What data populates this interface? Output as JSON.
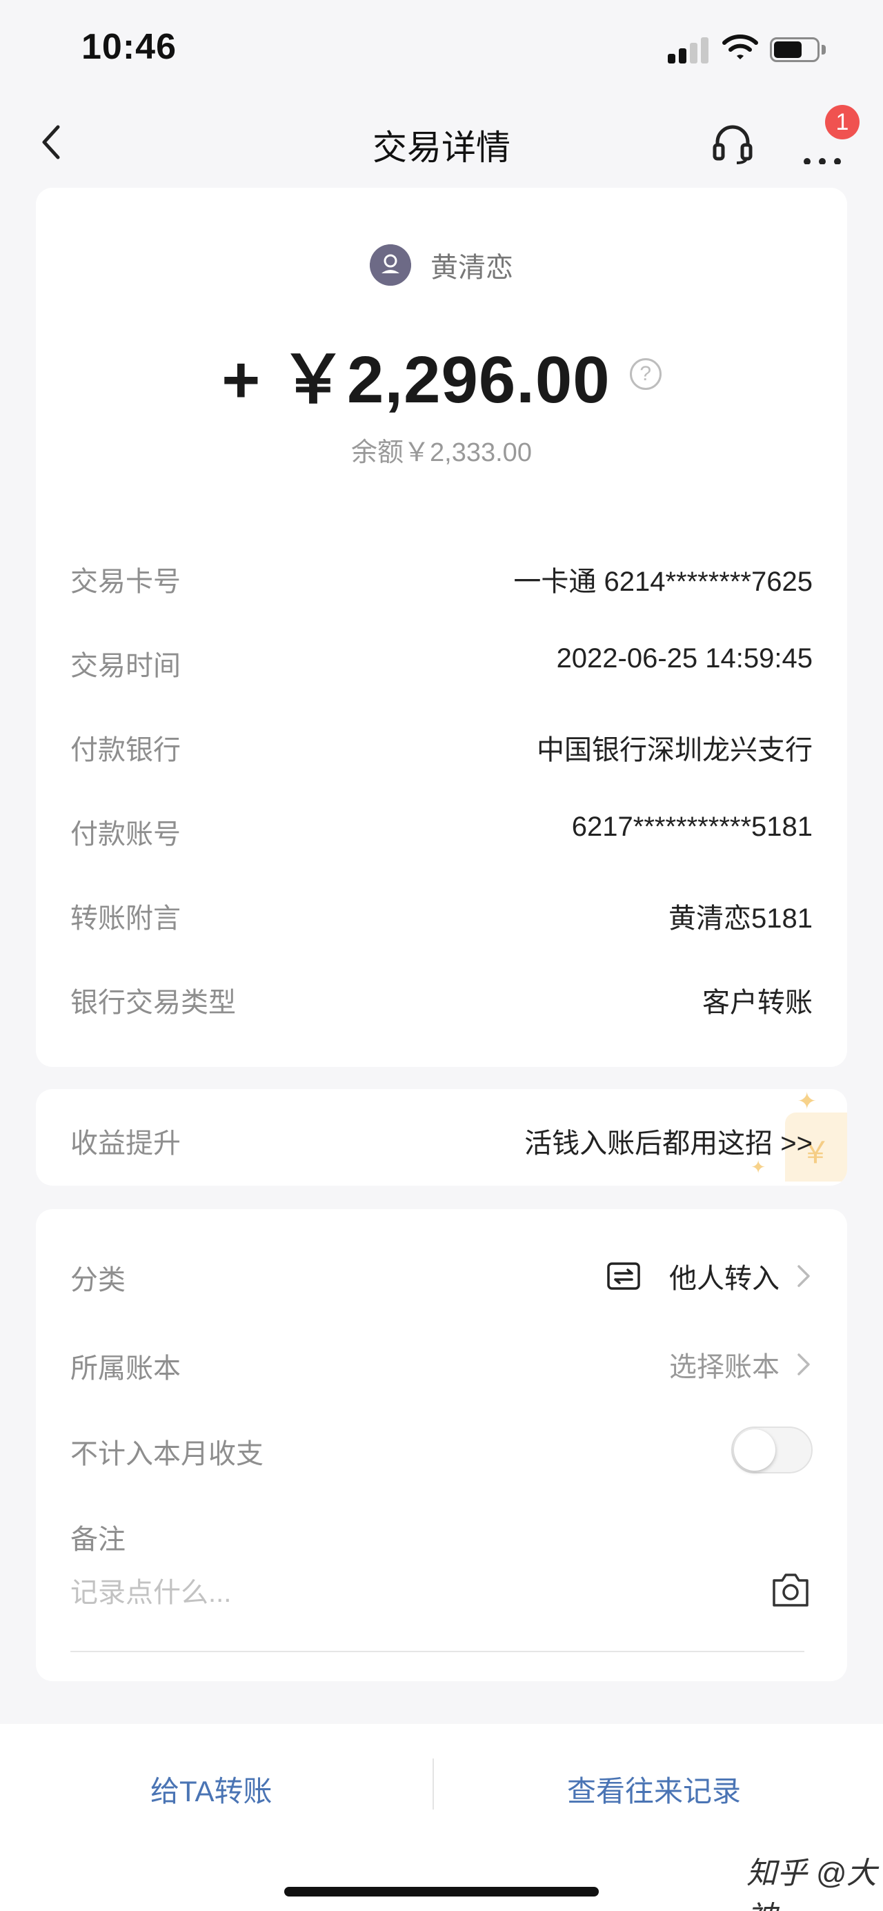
{
  "status_bar": {
    "time": "10:46"
  },
  "nav": {
    "title": "交易详情",
    "badge_count": "1",
    "icons": [
      "back-icon",
      "headset-icon",
      "more-icon"
    ]
  },
  "summary": {
    "payer_name": "黄清恋",
    "amount": "+ ￥2,296.00",
    "help_symbol": "?",
    "balance": "余额￥2,333.00"
  },
  "details": [
    {
      "label": "交易卡号",
      "value": "一卡通 6214********7625"
    },
    {
      "label": "交易时间",
      "value": "2022-06-25 14:59:45"
    },
    {
      "label": "付款银行",
      "value": "中国银行深圳龙兴支行"
    },
    {
      "label": "付款账号",
      "value": "6217***********5181"
    },
    {
      "label": "转账附言",
      "value": "黄清恋5181"
    },
    {
      "label": "银行交易类型",
      "value": "客户转账"
    }
  ],
  "promo": {
    "label": "收益提升",
    "link": "活钱入账后都用这招 >>",
    "deco_symbol": "￥"
  },
  "extra": {
    "category_label": "分类",
    "category_value": "他人转入",
    "ledger_label": "所属账本",
    "ledger_value": "选择账本",
    "exclude_label": "不计入本月收支",
    "exclude_enabled": false,
    "note_label": "备注",
    "note_placeholder": "记录点什么..."
  },
  "bottom": {
    "transfer_button": "给TA转账",
    "history_button": "查看往来记录",
    "watermark": "知乎 @大神"
  },
  "colors": {
    "link_blue": "#4a74b4",
    "badge_red": "#f05250",
    "avatar": "#6d6a86"
  }
}
